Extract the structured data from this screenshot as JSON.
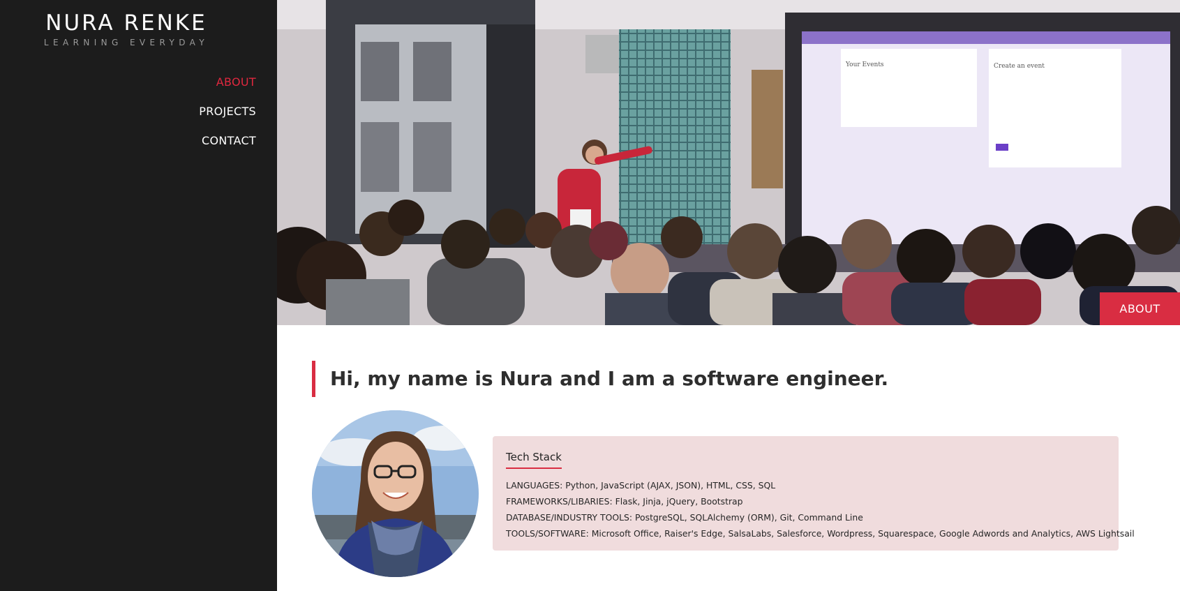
{
  "sidebar": {
    "brand_name": "NURA RENKE",
    "brand_tagline": "LEARNING EVERYDAY",
    "nav": [
      {
        "label": "ABOUT",
        "active": true
      },
      {
        "label": "PROJECTS",
        "active": false
      },
      {
        "label": "CONTACT",
        "active": false
      }
    ]
  },
  "hero": {
    "badge_label": "ABOUT",
    "screen_left_title": "Your Events",
    "screen_right_title": "Create an event"
  },
  "main": {
    "intro": "Hi, my name is Nura and I am a software engineer.",
    "tech_stack": {
      "title": "Tech Stack",
      "lines": [
        "LANGUAGES: Python, JavaScript (AJAX, JSON), HTML, CSS, SQL",
        "FRAMEWORKS/LIBARIES: Flask, Jinja, jQuery, Bootstrap",
        "DATABASE/INDUSTRY TOOLS: PostgreSQL, SQLAlchemy (ORM), Git, Command Line",
        "TOOLS/SOFTWARE: Microsoft Office, Raiser's Edge, SalsaLabs, Salesforce, Wordpress, Squarespace, Google Adwords and Analytics, AWS Lightsail"
      ]
    }
  },
  "colors": {
    "accent": "#d92d42",
    "sidebar_bg": "#1c1c1c",
    "card_bg": "#f0dcdd"
  }
}
